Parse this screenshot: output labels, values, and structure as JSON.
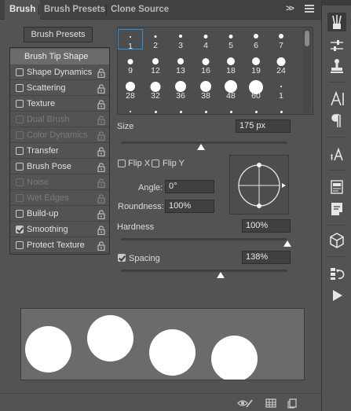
{
  "tabs": [
    {
      "label": "Brush",
      "active": true
    },
    {
      "label": "Brush Presets",
      "active": false
    },
    {
      "label": "Clone Source",
      "active": false
    }
  ],
  "collapse_label": ">>",
  "presets_button": "Brush Presets",
  "options": [
    {
      "label": "Brush Tip Shape",
      "type": "header"
    },
    {
      "label": "Shape Dynamics",
      "checked": false,
      "enabled": true
    },
    {
      "label": "Scattering",
      "checked": false,
      "enabled": true
    },
    {
      "label": "Texture",
      "checked": false,
      "enabled": true
    },
    {
      "label": "Dual Brush",
      "checked": false,
      "enabled": false
    },
    {
      "label": "Color Dynamics",
      "checked": false,
      "enabled": false
    },
    {
      "label": "Transfer",
      "checked": false,
      "enabled": true
    },
    {
      "label": "Brush Pose",
      "checked": false,
      "enabled": true
    },
    {
      "label": "Noise",
      "checked": false,
      "enabled": false
    },
    {
      "label": "Wet Edges",
      "checked": false,
      "enabled": false
    },
    {
      "label": "Build-up",
      "checked": false,
      "enabled": true
    },
    {
      "label": "Smoothing",
      "checked": true,
      "enabled": true
    },
    {
      "label": "Protect Texture",
      "checked": false,
      "enabled": true
    }
  ],
  "brush_tips": [
    "1",
    "2",
    "3",
    "4",
    "5",
    "6",
    "7",
    "9",
    "12",
    "13",
    "16",
    "18",
    "19",
    "24",
    "28",
    "32",
    "36",
    "38",
    "48",
    "60",
    "1"
  ],
  "size": {
    "label": "Size",
    "value": "175 px",
    "slider": 0.48
  },
  "flip_x": {
    "label": "Flip X",
    "checked": false
  },
  "flip_y": {
    "label": "Flip Y",
    "checked": false
  },
  "angle": {
    "label": "Angle:",
    "value": "0°"
  },
  "roundness": {
    "label": "Roundness:",
    "value": "100%"
  },
  "hardness": {
    "label": "Hardness",
    "value": "100%",
    "slider": 1.0
  },
  "spacing": {
    "label": "Spacing",
    "value": "138%",
    "checked": true,
    "slider": 0.6
  },
  "icons": {
    "footer": [
      "eye-brush-icon",
      "grid-panel-icon",
      "new-preset-icon"
    ],
    "toolbar": [
      "brush-panel-icon",
      "brush-settings-icon",
      "clone-stamp-icon",
      "character-icon",
      "paragraph-icon",
      "character-styles-icon",
      "paragraph-styles-icon",
      "notes-icon",
      "3d-icon",
      "history-icon",
      "play-icon"
    ]
  },
  "colors": {
    "panel": "#535353",
    "accent": "#2f8ed8"
  }
}
